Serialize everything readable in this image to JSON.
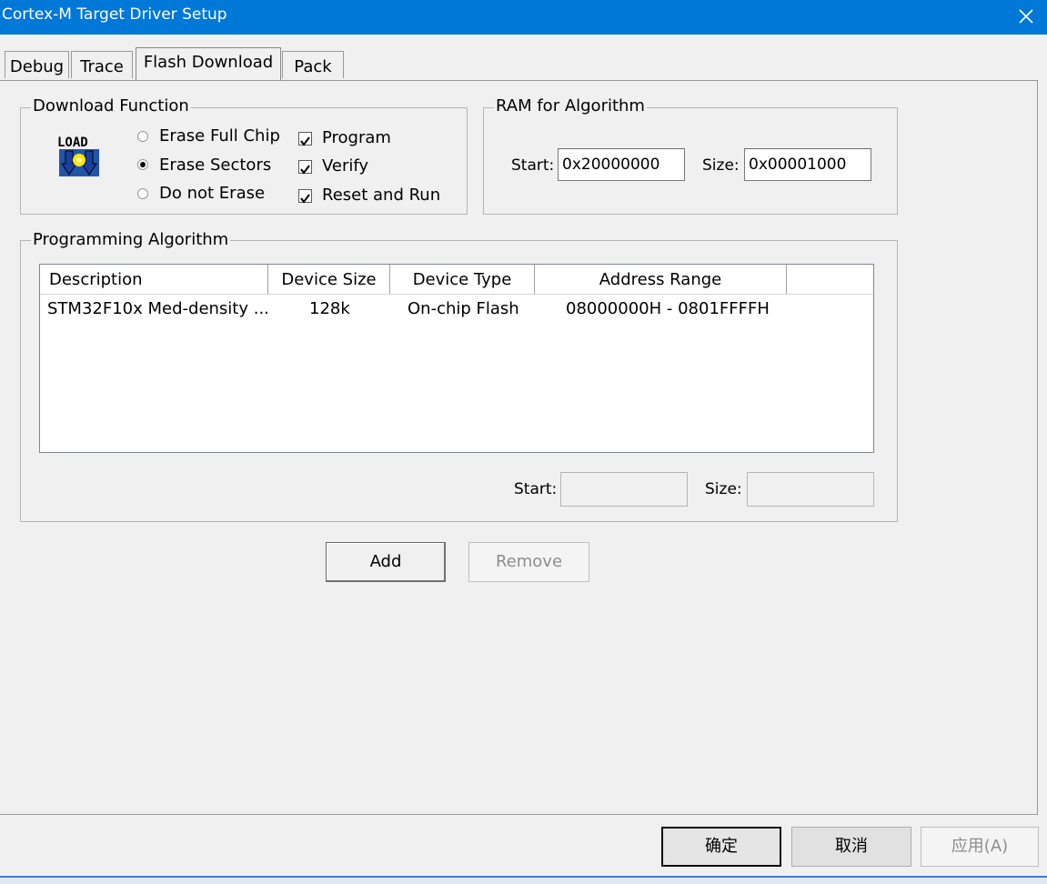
{
  "window": {
    "title": "Cortex-M Target Driver Setup"
  },
  "tabs": [
    {
      "label": "Debug"
    },
    {
      "label": "Trace"
    },
    {
      "label": "Flash Download"
    },
    {
      "label": "Pack"
    }
  ],
  "download_function": {
    "legend": "Download Function",
    "icon_text": "LOAD",
    "erase_options": [
      {
        "label": "Erase Full Chip",
        "selected": false
      },
      {
        "label": "Erase Sectors",
        "selected": true
      },
      {
        "label": "Do not Erase",
        "selected": false
      }
    ],
    "checks": [
      {
        "label": "Program",
        "checked": true
      },
      {
        "label": "Verify",
        "checked": true
      },
      {
        "label": "Reset and Run",
        "checked": true
      }
    ]
  },
  "ram": {
    "legend": "RAM for Algorithm",
    "start_label": "Start:",
    "start_value": "0x20000000",
    "size_label": "Size:",
    "size_value": "0x00001000"
  },
  "algorithm": {
    "legend": "Programming Algorithm",
    "columns": [
      "Description",
      "Device Size",
      "Device Type",
      "Address Range"
    ],
    "rows": [
      {
        "description": "STM32F10x Med-density ...",
        "size": "128k",
        "type": "On-chip Flash",
        "range": "08000000H - 0801FFFFH"
      }
    ],
    "start_label": "Start:",
    "start_value": "",
    "size_label": "Size:",
    "size_value": ""
  },
  "actions": {
    "add": "Add",
    "remove": "Remove"
  },
  "dialog_buttons": {
    "ok": "确定",
    "cancel": "取消",
    "apply": "应用(A)"
  },
  "colors": {
    "titlebar": "#0078d7",
    "dialog_bg": "#f0f0f0"
  }
}
